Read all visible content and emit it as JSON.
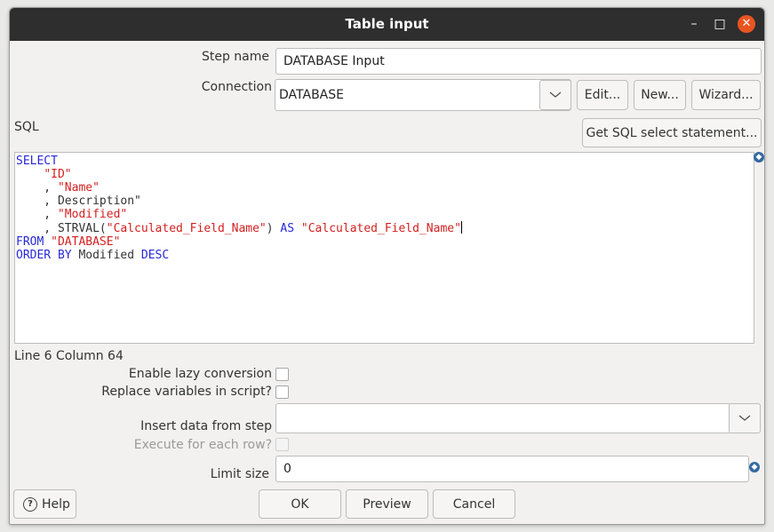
{
  "window": {
    "title": "Table input",
    "minimize_glyph": "–",
    "maximize_glyph": "□",
    "close_glyph": "✕"
  },
  "form": {
    "step_name_label": "Step name",
    "step_name_value": "DATABASE Input",
    "connection_label": "Connection",
    "connection_value": "DATABASE",
    "edit_label": "Edit...",
    "new_label": "New...",
    "wizard_label": "Wizard...",
    "sql_label": "SQL",
    "get_sql_label": "Get SQL select statement...",
    "sql_lines": [
      [
        {
          "t": "SELECT",
          "c": "kw"
        }
      ],
      [
        {
          "t": "    ",
          "c": "plain"
        },
        {
          "t": "\"ID\"",
          "c": "str"
        }
      ],
      [
        {
          "t": "    , ",
          "c": "plain"
        },
        {
          "t": "\"Name\"",
          "c": "str"
        }
      ],
      [
        {
          "t": "    , Description\"",
          "c": "plain"
        }
      ],
      [
        {
          "t": "    , ",
          "c": "plain"
        },
        {
          "t": "\"Modified\"",
          "c": "str"
        }
      ],
      [
        {
          "t": "    , STRVAL(",
          "c": "plain"
        },
        {
          "t": "\"Calculated_Field_Name\"",
          "c": "str"
        },
        {
          "t": ") ",
          "c": "plain"
        },
        {
          "t": "AS",
          "c": "kw"
        },
        {
          "t": " ",
          "c": "plain"
        },
        {
          "t": "\"Calculated_Field_Name\"",
          "c": "str"
        }
      ],
      [
        {
          "t": "FROM",
          "c": "kw"
        },
        {
          "t": " ",
          "c": "plain"
        },
        {
          "t": "\"DATABASE\"",
          "c": "str"
        }
      ],
      [
        {
          "t": "ORDER BY",
          "c": "kw"
        },
        {
          "t": " Modified ",
          "c": "plain"
        },
        {
          "t": "DESC",
          "c": "kw"
        }
      ]
    ],
    "cursor_line_index": 5,
    "cursor_position": "Line 6 Column 64",
    "lazy_conversion_label": "Enable lazy conversion",
    "lazy_conversion_checked": false,
    "replace_variables_label": "Replace variables in script?",
    "replace_variables_checked": false,
    "insert_data_label": "Insert data from step",
    "insert_data_value": "",
    "execute_each_row_label": "Execute for each row?",
    "execute_each_row_checked": false,
    "limit_size_label": "Limit size",
    "limit_size_value": "0"
  },
  "buttons": {
    "help": "Help",
    "ok": "OK",
    "preview": "Preview",
    "cancel": "Cancel"
  },
  "icons": {
    "help": "question-circle-icon",
    "variable": "variable-diamond-icon",
    "dropdown": "chevron-down-icon"
  },
  "colors": {
    "title_bar": "#2e2e2e",
    "close_button": "#e95420",
    "sql_keyword": "#2828d8",
    "sql_string": "#d42020"
  }
}
